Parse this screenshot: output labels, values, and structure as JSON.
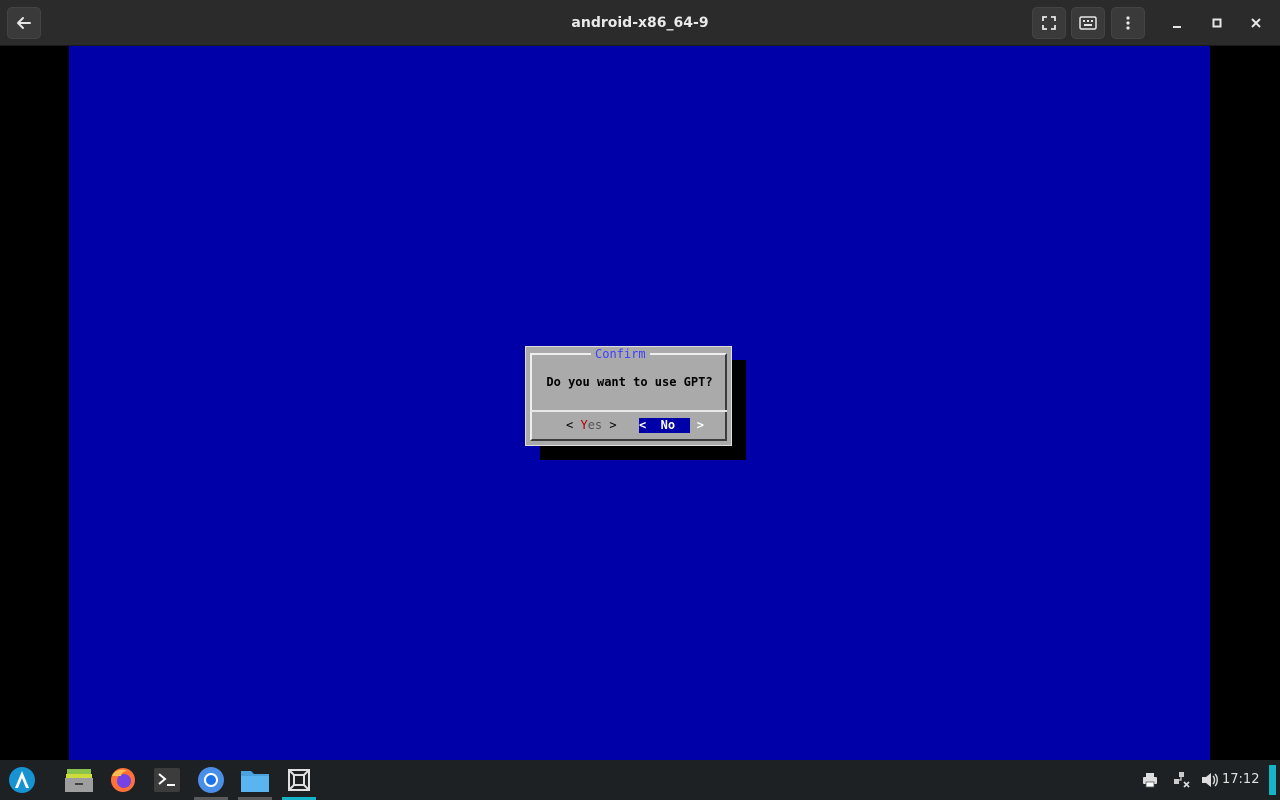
{
  "window": {
    "title": "android-x86_64-9"
  },
  "dialog": {
    "title": "Confirm",
    "message": "Do you want to use GPT?",
    "yes_left": "< ",
    "yes_hot": "Y",
    "yes_rest": "es",
    "yes_right": " >",
    "no_label": "<  No   >"
  },
  "taskbar": {
    "clock": "17:12"
  },
  "colors": {
    "vm_background": "#0000a8",
    "dialog_background": "#aaaaaa",
    "dialog_title": "#3f3fff",
    "hotkey": "#aa0000",
    "accent": "#17b3c9"
  }
}
